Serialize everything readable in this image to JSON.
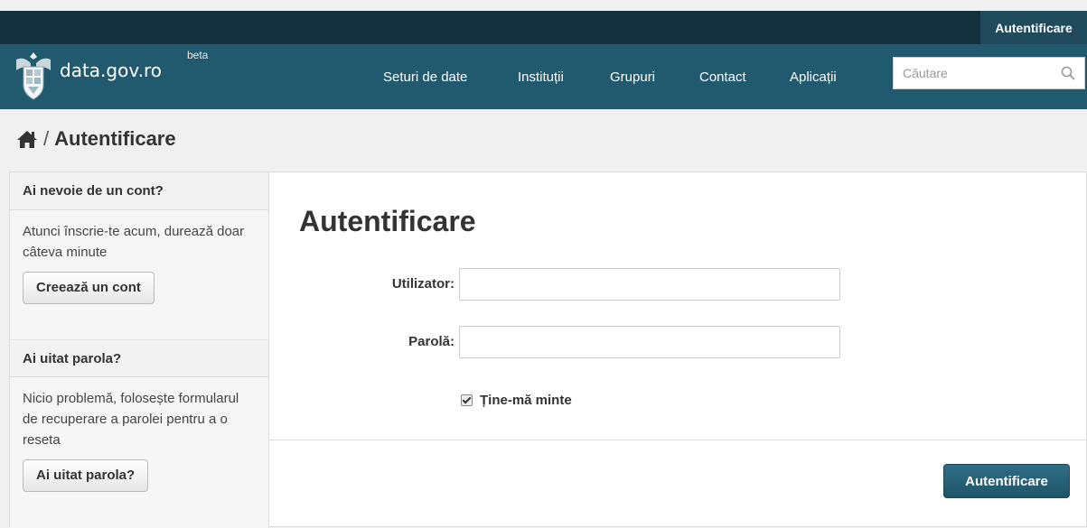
{
  "topbar": {
    "login_link": "Autentificare"
  },
  "brand": {
    "site_name": "data.gov.ro",
    "badge": "beta"
  },
  "nav": {
    "items": [
      "Seturi de date",
      "Instituții",
      "Grupuri",
      "Contact",
      "Aplicații"
    ]
  },
  "search": {
    "placeholder": "Căutare"
  },
  "breadcrumb": {
    "separator": "/",
    "current": "Autentificare"
  },
  "sidebar": {
    "signup": {
      "heading": "Ai nevoie de un cont?",
      "text": "Atunci înscrie-te acum, durează doar câteva minute",
      "button": "Creează un cont"
    },
    "forgot": {
      "heading": "Ai uitat parola?",
      "text": "Nicio problemă, folosește formularul de recuperare a parolei pentru a o reseta",
      "button": "Ai uitat parola?"
    }
  },
  "login_form": {
    "title": "Autentificare",
    "username_label": "Utilizator:",
    "username_value": "",
    "password_label": "Parolă:",
    "password_value": "",
    "remember_label": "Ține-mă minte",
    "remember_checked": true,
    "submit": "Autentificare"
  },
  "colors": {
    "topbar": "#12313d",
    "navbar": "#215a6e",
    "primary_button": "#1f5468"
  },
  "icons": {
    "search": "search-icon",
    "home": "home-icon",
    "crest": "coat-of-arms-icon"
  }
}
